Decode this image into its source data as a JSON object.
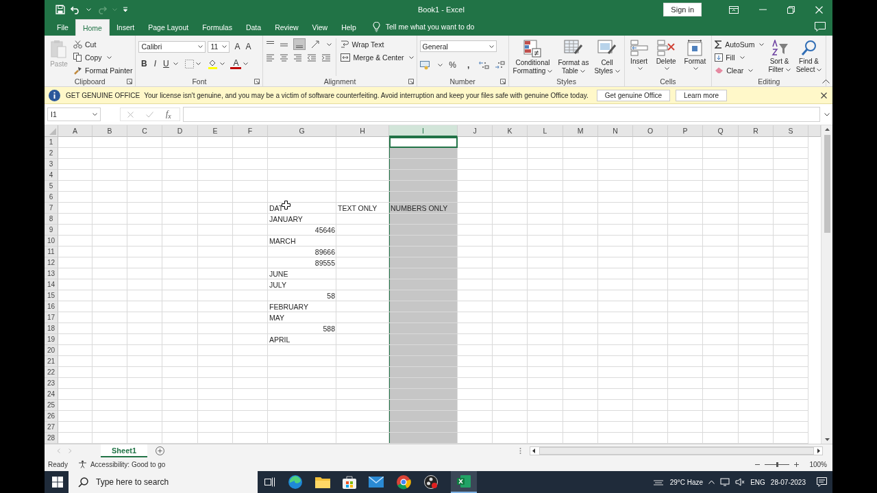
{
  "title_bar": {
    "title": "Book1  -  Excel",
    "sign_in": "Sign in"
  },
  "ribbon_tabs": [
    {
      "label": "File",
      "selected": false
    },
    {
      "label": "Home",
      "selected": true
    },
    {
      "label": "Insert",
      "selected": false
    },
    {
      "label": "Page Layout",
      "selected": false
    },
    {
      "label": "Formulas",
      "selected": false
    },
    {
      "label": "Data",
      "selected": false
    },
    {
      "label": "Review",
      "selected": false
    },
    {
      "label": "View",
      "selected": false
    },
    {
      "label": "Help",
      "selected": false
    }
  ],
  "tell_me": "Tell me what you want to do",
  "ribbon": {
    "clipboard": {
      "label": "Clipboard",
      "paste": "Paste",
      "cut": "Cut",
      "copy": "Copy",
      "format_painter": "Format Painter"
    },
    "font": {
      "label": "Font",
      "family": "Calibri",
      "size": "11",
      "grow": "A",
      "shrink": "A",
      "bold": "B",
      "italic": "I",
      "underline": "U",
      "font_color": "A"
    },
    "alignment": {
      "label": "Alignment",
      "wrap_text": "Wrap Text",
      "merge_center": "Merge & Center"
    },
    "number": {
      "label": "Number",
      "format": "General",
      "percent": "%",
      "comma": ","
    },
    "styles": {
      "label": "Styles",
      "buttons": [
        {
          "kind": "conditional",
          "lines": [
            "Conditional",
            "Formatting"
          ]
        },
        {
          "kind": "table",
          "lines": [
            "Format as",
            "Table"
          ]
        },
        {
          "kind": "cellstyles",
          "lines": [
            "Cell",
            "Styles"
          ]
        }
      ]
    },
    "cells": {
      "label": "Cells",
      "buttons": [
        {
          "kind": "insert",
          "label": "Insert"
        },
        {
          "kind": "delete",
          "label": "Delete"
        },
        {
          "kind": "format",
          "label": "Format"
        }
      ]
    },
    "editing": {
      "label": "Editing",
      "autosum": "AutoSum",
      "fill": "Fill",
      "clear": "Clear",
      "sort": [
        "Sort &",
        "Filter"
      ],
      "find": [
        "Find &",
        "Select"
      ]
    }
  },
  "message_bar": {
    "title": "GET GENUINE OFFICE",
    "text": "Your license isn't genuine, and you may be a victim of software counterfeiting. Avoid interruption and keep your files safe with genuine Office today.",
    "buttons": [
      "Get genuine Office",
      "Learn more"
    ]
  },
  "formula_bar": {
    "name_box": "I1",
    "fx": "f$_{x}$"
  },
  "grid": {
    "columns": [
      {
        "label": "A",
        "selected": false
      },
      {
        "label": "B",
        "selected": false
      },
      {
        "label": "C",
        "selected": false
      },
      {
        "label": "D",
        "selected": false
      },
      {
        "label": "E",
        "selected": false
      },
      {
        "label": "F",
        "selected": false
      },
      {
        "label": "G",
        "selected": false
      },
      {
        "label": "H",
        "selected": false
      },
      {
        "label": "I",
        "selected": true
      },
      {
        "label": "J",
        "selected": false
      },
      {
        "label": "K",
        "selected": false
      },
      {
        "label": "L",
        "selected": false
      },
      {
        "label": "M",
        "selected": false
      },
      {
        "label": "N",
        "selected": false
      },
      {
        "label": "O",
        "selected": false
      },
      {
        "label": "P",
        "selected": false
      },
      {
        "label": "Q",
        "selected": false
      },
      {
        "label": "R",
        "selected": false
      },
      {
        "label": "S",
        "selected": false
      }
    ],
    "rows": [
      {
        "label": "1",
        "cells": {
          "I": {
            "active": true
          }
        }
      },
      {
        "label": "2"
      },
      {
        "label": "3"
      },
      {
        "label": "4"
      },
      {
        "label": "5"
      },
      {
        "label": "6"
      },
      {
        "label": "7",
        "cells": {
          "G": {
            "text": "DAT",
            "kind": "text"
          },
          "H": {
            "text": "TEXT ONLY",
            "kind": "text"
          },
          "I": {
            "text": "NUMBERS ONLY",
            "kind": "text"
          }
        }
      },
      {
        "label": "8",
        "cells": {
          "G": {
            "text": "JANUARY",
            "kind": "text"
          }
        }
      },
      {
        "label": "9",
        "cells": {
          "G": {
            "text": "45646",
            "kind": "number"
          }
        }
      },
      {
        "label": "10",
        "cells": {
          "G": {
            "text": "MARCH",
            "kind": "text"
          }
        }
      },
      {
        "label": "11",
        "cells": {
          "G": {
            "text": "89666",
            "kind": "number"
          }
        }
      },
      {
        "label": "12",
        "cells": {
          "G": {
            "text": "89555",
            "kind": "number"
          }
        }
      },
      {
        "label": "13",
        "cells": {
          "G": {
            "text": "JUNE",
            "kind": "text"
          }
        }
      },
      {
        "label": "14",
        "cells": {
          "G": {
            "text": "JULY",
            "kind": "text"
          }
        }
      },
      {
        "label": "15",
        "cells": {
          "G": {
            "text": "58",
            "kind": "number"
          }
        }
      },
      {
        "label": "16",
        "cells": {
          "G": {
            "text": "FEBRUARY",
            "kind": "text"
          }
        }
      },
      {
        "label": "17",
        "cells": {
          "G": {
            "text": "MAY",
            "kind": "text"
          }
        }
      },
      {
        "label": "18",
        "cells": {
          "G": {
            "text": "588",
            "kind": "number"
          }
        }
      },
      {
        "label": "19",
        "cells": {
          "G": {
            "text": "APRIL",
            "kind": "text"
          }
        }
      },
      {
        "label": "20"
      },
      {
        "label": "21"
      },
      {
        "label": "22"
      },
      {
        "label": "23"
      },
      {
        "label": "24"
      },
      {
        "label": "25"
      },
      {
        "label": "26"
      },
      {
        "label": "27"
      },
      {
        "label": "28"
      }
    ]
  },
  "sheet_tabs": [
    {
      "label": "Sheet1",
      "selected": true
    }
  ],
  "status_bar": {
    "status": "Ready",
    "accessibility": "Accessibility: Good to go",
    "zoom_slider": {
      "level": 0.5
    },
    "zoom": "100%"
  },
  "taskbar": {
    "search_placeholder": "Type here to search",
    "weather": "29°C  Haze",
    "language": "ENG",
    "date": "28-07-2023"
  }
}
